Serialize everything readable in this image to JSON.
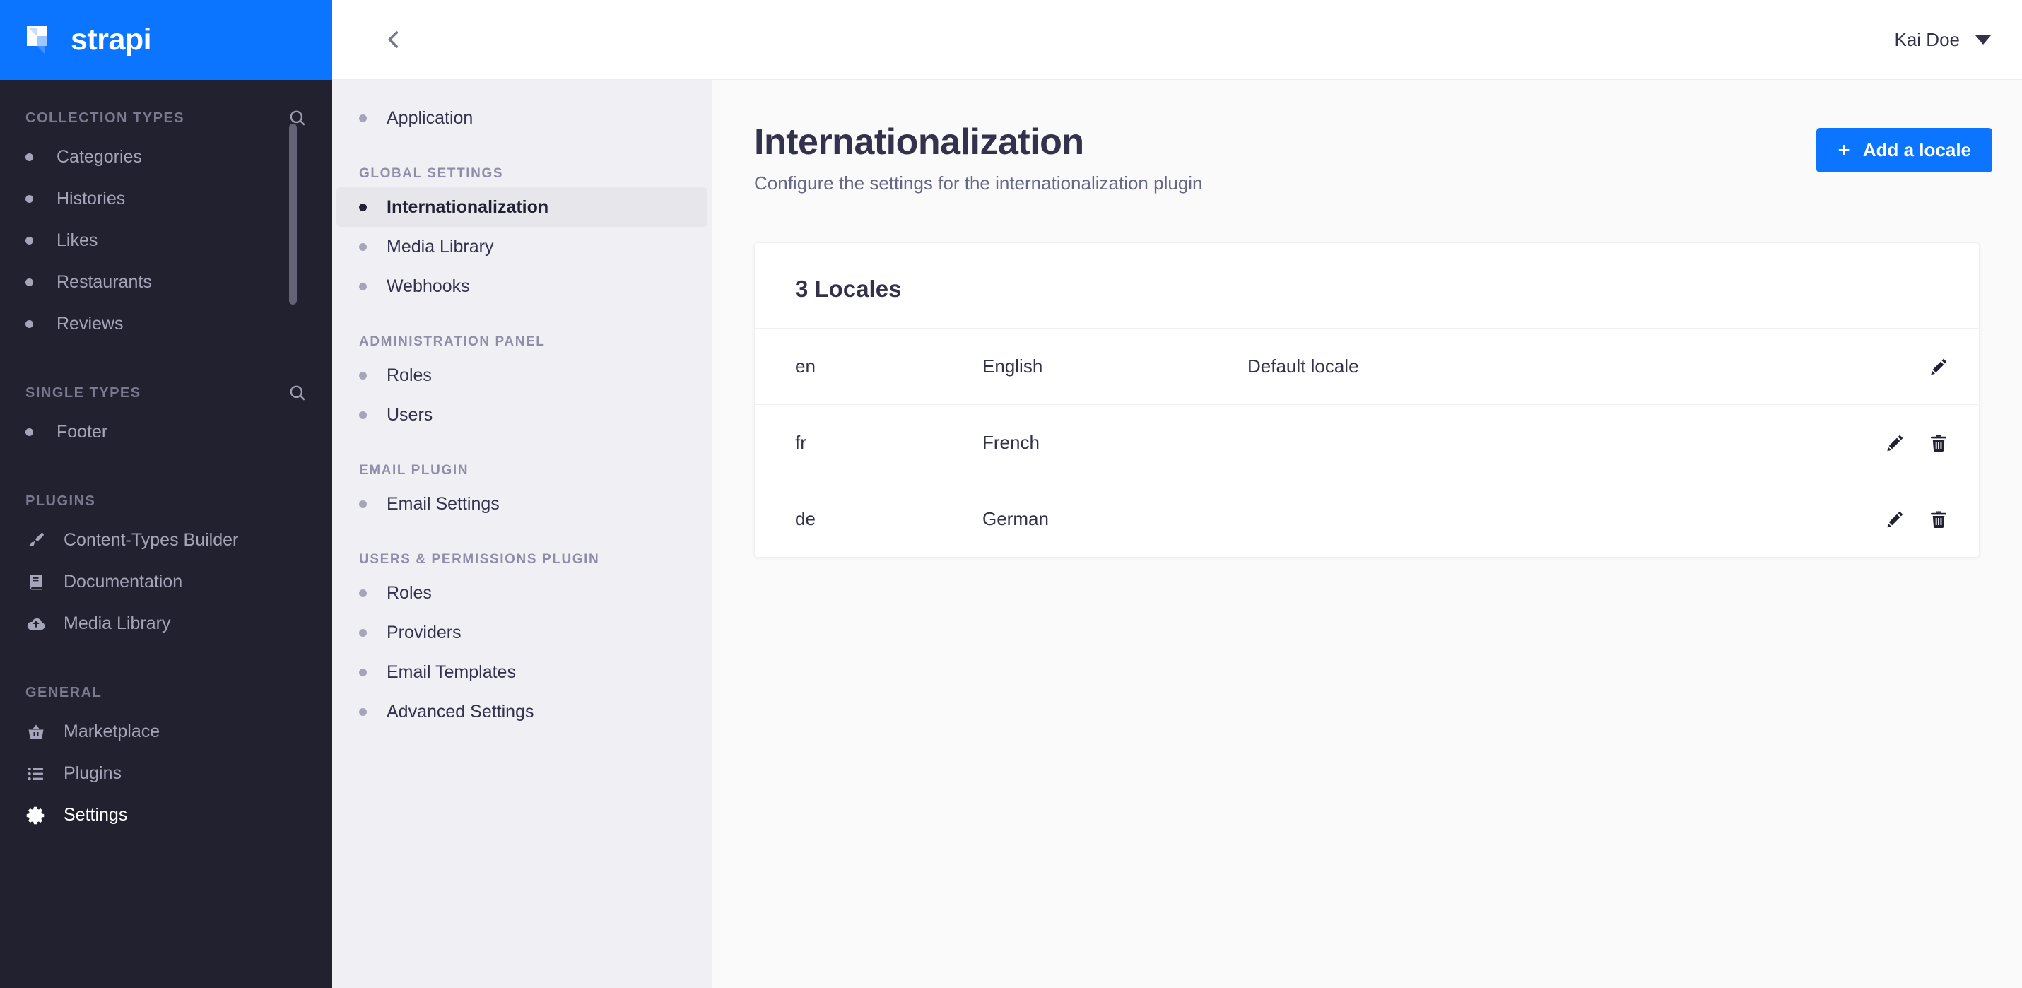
{
  "brand": {
    "name": "strapi",
    "logo_icon": "strapi-logo-icon",
    "accent_color": "#0c75ff"
  },
  "topbar": {
    "user_name": "Kai Doe",
    "caret_icon": "chevron-down-icon",
    "back_icon": "chevron-left-icon"
  },
  "leftnav": {
    "sections": [
      {
        "title": "COLLECTION TYPES",
        "search_icon": "search-icon",
        "has_search": true,
        "items": [
          {
            "label": "Categories",
            "icon": "bullet",
            "active": false
          },
          {
            "label": "Histories",
            "icon": "bullet",
            "active": false
          },
          {
            "label": "Likes",
            "icon": "bullet",
            "active": false
          },
          {
            "label": "Restaurants",
            "icon": "bullet",
            "active": false
          },
          {
            "label": "Reviews",
            "icon": "bullet",
            "active": false
          }
        ]
      },
      {
        "title": "SINGLE TYPES",
        "search_icon": "search-icon",
        "has_search": true,
        "items": [
          {
            "label": "Footer",
            "icon": "bullet",
            "active": false
          }
        ]
      },
      {
        "title": "PLUGINS",
        "has_search": false,
        "items": [
          {
            "label": "Content-Types Builder",
            "icon": "paint-brush-icon",
            "active": false
          },
          {
            "label": "Documentation",
            "icon": "book-icon",
            "active": false
          },
          {
            "label": "Media Library",
            "icon": "cloud-upload-icon",
            "active": false
          }
        ]
      },
      {
        "title": "GENERAL",
        "has_search": false,
        "items": [
          {
            "label": "Marketplace",
            "icon": "shopping-basket-icon",
            "active": false
          },
          {
            "label": "Plugins",
            "icon": "list-icon",
            "active": false
          },
          {
            "label": "Settings",
            "icon": "gear-icon",
            "active": true
          }
        ]
      }
    ]
  },
  "settings_panel": {
    "groups": [
      {
        "title": "",
        "items": [
          {
            "label": "Application",
            "active": false
          }
        ]
      },
      {
        "title": "GLOBAL SETTINGS",
        "items": [
          {
            "label": "Internationalization",
            "active": true
          },
          {
            "label": "Media Library",
            "active": false
          },
          {
            "label": "Webhooks",
            "active": false
          }
        ]
      },
      {
        "title": "ADMINISTRATION PANEL",
        "items": [
          {
            "label": "Roles",
            "active": false
          },
          {
            "label": "Users",
            "active": false
          }
        ]
      },
      {
        "title": "EMAIL PLUGIN",
        "items": [
          {
            "label": "Email Settings",
            "active": false
          }
        ]
      },
      {
        "title": "USERS & PERMISSIONS PLUGIN",
        "items": [
          {
            "label": "Roles",
            "active": false
          },
          {
            "label": "Providers",
            "active": false
          },
          {
            "label": "Email Templates",
            "active": false
          },
          {
            "label": "Advanced Settings",
            "active": false
          }
        ]
      }
    ]
  },
  "page": {
    "title": "Internationalization",
    "subtitle": "Configure the settings for the internationalization plugin",
    "add_button_label": "Add a locale",
    "add_button_icon": "plus-icon"
  },
  "locales_card": {
    "heading": "3 Locales",
    "count": 3,
    "rows": [
      {
        "code": "en",
        "name": "English",
        "default_label": "Default locale",
        "can_edit": true,
        "can_delete": false
      },
      {
        "code": "fr",
        "name": "French",
        "default_label": "",
        "can_edit": true,
        "can_delete": true
      },
      {
        "code": "de",
        "name": "German",
        "default_label": "",
        "can_edit": true,
        "can_delete": true
      }
    ],
    "edit_icon": "pencil-icon",
    "delete_icon": "trash-icon"
  }
}
